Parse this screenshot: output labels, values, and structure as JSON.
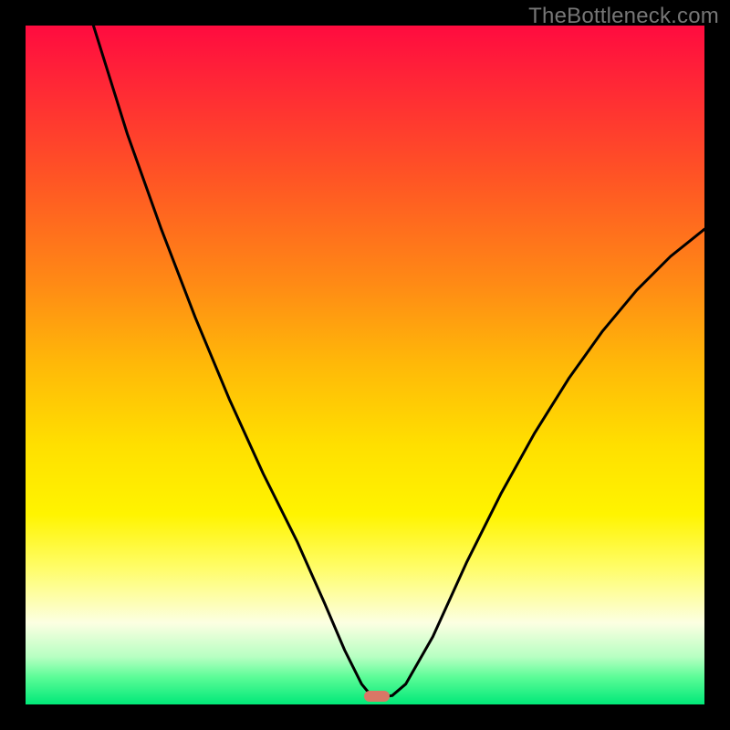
{
  "watermark": "TheBottleneck.com",
  "chart_data": {
    "type": "line",
    "title": "",
    "xlabel": "",
    "ylabel": "",
    "xlim": [
      0,
      100
    ],
    "ylim": [
      0,
      100
    ],
    "series": [
      {
        "name": "curve",
        "x": [
          10,
          15,
          20,
          25,
          30,
          35,
          40,
          44,
          47,
          49.5,
          51,
          52.5,
          54,
          56,
          60,
          65,
          70,
          75,
          80,
          85,
          90,
          95,
          100
        ],
        "y": [
          100,
          84,
          70,
          57,
          45,
          34,
          24,
          15,
          8,
          3,
          1.2,
          1.1,
          1.3,
          3,
          10,
          21,
          31,
          40,
          48,
          55,
          61,
          66,
          70
        ]
      }
    ],
    "marker": {
      "x": 51.8,
      "y": 1.2
    },
    "colors": {
      "curve": "#000000",
      "marker": "#d97766",
      "gradient_top": "#ff0b3f",
      "gradient_bottom": "#00e878"
    }
  }
}
